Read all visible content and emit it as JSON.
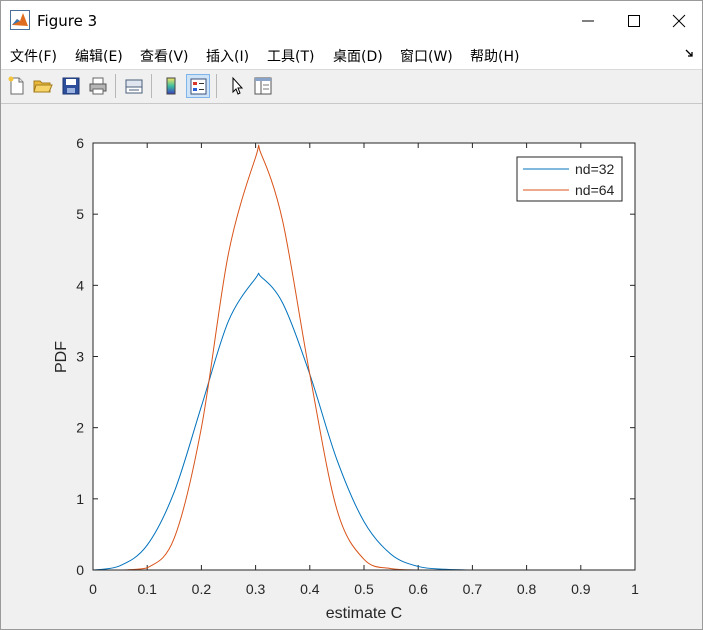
{
  "window": {
    "title": "Figure 3",
    "icon": "matlab-logo-icon",
    "controls": [
      "minimize-icon",
      "maximize-icon",
      "close-icon"
    ]
  },
  "menu": {
    "items": [
      {
        "label": "文件(F)"
      },
      {
        "label": "编辑(E)"
      },
      {
        "label": "查看(V)"
      },
      {
        "label": "插入(I)"
      },
      {
        "label": "工具(T)"
      },
      {
        "label": "桌面(D)"
      },
      {
        "label": "窗口(W)"
      },
      {
        "label": "帮助(H)"
      }
    ]
  },
  "toolbar": {
    "buttons": [
      {
        "icon": "new-figure-icon"
      },
      {
        "icon": "open-folder-icon"
      },
      {
        "icon": "save-icon"
      },
      {
        "icon": "print-icon"
      },
      {
        "icon": "link-plot-icon"
      },
      {
        "icon": "colorbar-icon"
      },
      {
        "icon": "legend-icon",
        "pressed": true
      },
      {
        "icon": "pointer-icon"
      },
      {
        "icon": "property-editor-icon"
      }
    ]
  },
  "colors": {
    "series1": "#0072BD",
    "series2": "#D95319",
    "axes_bg": "#ffffff",
    "figure_bg": "#f0f0f0"
  },
  "chart_data": {
    "type": "line",
    "xlabel": "estimate C",
    "ylabel": "PDF",
    "xlim": [
      0,
      1
    ],
    "ylim": [
      0,
      6
    ],
    "xticks": [
      "0",
      "0.1",
      "0.2",
      "0.3",
      "0.4",
      "0.5",
      "0.6",
      "0.7",
      "0.8",
      "0.9",
      "1"
    ],
    "yticks": [
      "0",
      "1",
      "2",
      "3",
      "4",
      "5",
      "6"
    ],
    "legend_position": "top-right",
    "grid": false,
    "series": [
      {
        "name": "nd=32",
        "x": [
          0.0,
          0.05,
          0.1,
          0.15,
          0.2,
          0.25,
          0.3,
          0.31,
          0.35,
          0.4,
          0.45,
          0.5,
          0.55,
          0.6,
          0.65,
          0.7,
          0.75,
          0.8,
          0.85,
          0.9,
          0.95,
          1.0
        ],
        "y": [
          0.0,
          0.06,
          0.35,
          1.1,
          2.3,
          3.5,
          4.1,
          4.12,
          3.75,
          2.75,
          1.55,
          0.68,
          0.22,
          0.05,
          0.01,
          0.0,
          0.0,
          0.0,
          0.0,
          0.0,
          0.0,
          0.0
        ]
      },
      {
        "name": "nd=64",
        "x": [
          0.0,
          0.05,
          0.1,
          0.15,
          0.2,
          0.25,
          0.3,
          0.31,
          0.35,
          0.4,
          0.45,
          0.5,
          0.55,
          0.6,
          0.65,
          0.7,
          0.75,
          0.8,
          0.85,
          0.9,
          0.95,
          1.0
        ],
        "y": [
          0.0,
          0.0,
          0.03,
          0.45,
          2.0,
          4.45,
          5.8,
          5.85,
          4.9,
          2.75,
          0.85,
          0.15,
          0.02,
          0.0,
          0.0,
          0.0,
          0.0,
          0.0,
          0.0,
          0.0,
          0.0,
          0.0
        ]
      }
    ]
  }
}
